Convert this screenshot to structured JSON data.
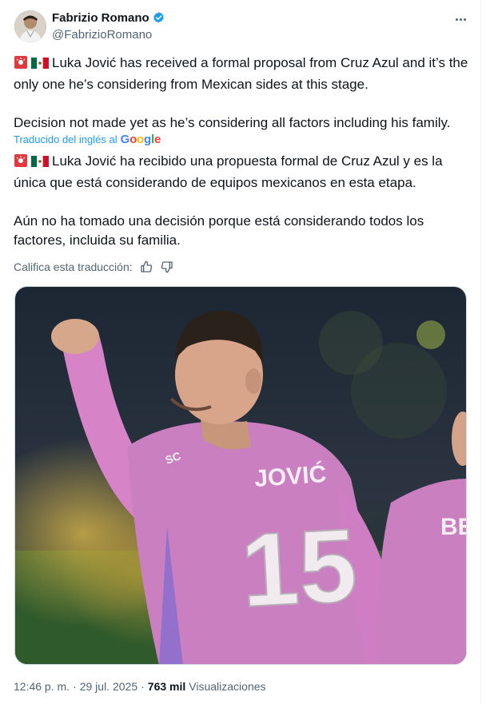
{
  "author": {
    "name": "Fabrizio Romano",
    "handle": "@FabrizioRomano"
  },
  "tweet": {
    "original_line1": "Luka Jović has received a formal proposal from Cruz Azul and it’s the only one he’s considering from Mexican sides at this stage.",
    "original_line2": "Decision not made yet as he’s considering all factors including his family.",
    "translated_label": "Traducido del inglés al",
    "translated_by": "Google",
    "translation_line1": "Luka Jović ha recibido una propuesta formal de Cruz Azul y es la única que está considerando de equipos mexicanos en esta etapa.",
    "translation_line2": "Aún no ha tomado una decisión porque está considerando todos los factores, incluida su familia.",
    "rate_label": "Califica esta traducción:"
  },
  "media": {
    "jersey_name": "JOVIĆ",
    "jersey_number": "15",
    "teammate_text": "BE"
  },
  "meta": {
    "time": "12:46 p. m.",
    "separator": "·",
    "date": "29 jul. 2025",
    "views": "763 mil",
    "views_label": "Visualizaciones"
  },
  "colors": {
    "accent": "#1d9bf0",
    "text": "#0f1419",
    "muted": "#536471",
    "jersey": "#c97fc0"
  }
}
